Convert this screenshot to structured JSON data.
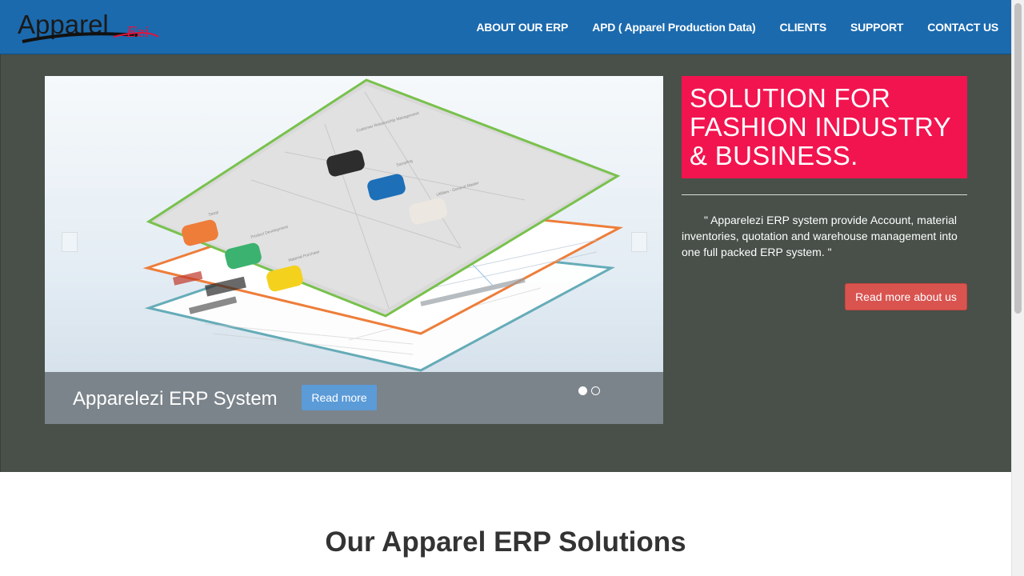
{
  "logo": {
    "main": "Appar",
    "main2": "el",
    "sub": "Ezi"
  },
  "nav": {
    "items": [
      {
        "label": "ABOUT OUR ERP"
      },
      {
        "label": "APD ( Apparel Production Data)"
      },
      {
        "label": "CLIENTS"
      },
      {
        "label": "SUPPORT"
      },
      {
        "label": "CONTACT US"
      }
    ]
  },
  "carousel": {
    "caption_title": "Apparelezi ERP System",
    "caption_button": "Read more",
    "slides": 2,
    "active_slide": 1
  },
  "promo": {
    "headline": "SOLUTION FOR FASHION INDUSTRY & BUSINESS.",
    "description": "\" Apparelezi ERP system provide Account, material inventories, quotation and warehouse management into one full packed ERP system. \"",
    "button": "Read more about us"
  },
  "solutions": {
    "title": "Our Apparel ERP Solutions"
  },
  "colors": {
    "navbar": "#1b6aae",
    "hero_bg": "#485049",
    "promo_bg": "#f2144f",
    "about_button": "#d9534f",
    "caption_button": "#5b9bd8"
  }
}
